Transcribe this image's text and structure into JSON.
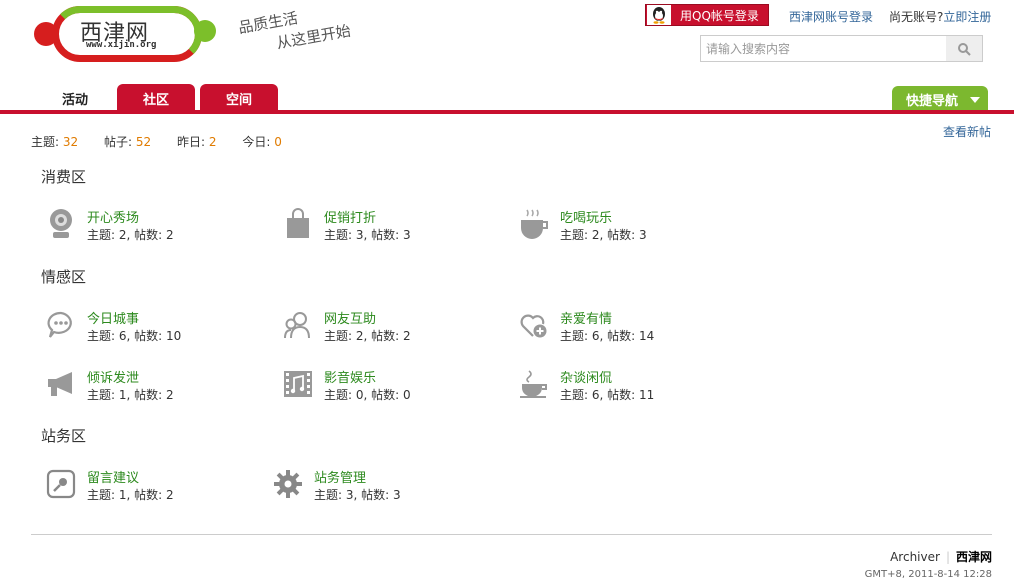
{
  "header": {
    "logo_name": "西津网",
    "logo_url": "www.xijin.org",
    "slogan_line1": "品质生活",
    "slogan_line2": "从这里开始",
    "qq_login": "用QQ帐号登录",
    "site_login": "西津网账号登录",
    "no_account": "尚无账号?",
    "register": "立即注册",
    "search_placeholder": "请输入搜索内容"
  },
  "nav": {
    "tabs": [
      {
        "label": "活动",
        "active": false
      },
      {
        "label": "社区",
        "active": true
      },
      {
        "label": "空间",
        "active": true
      }
    ],
    "quick_nav": "快捷导航"
  },
  "stats": {
    "topics_label": "主题:",
    "topics": "32",
    "posts_label": "帖子:",
    "posts": "52",
    "yesterday_label": "昨日:",
    "yesterday": "2",
    "today_label": "今日:",
    "today": "0",
    "view_new": "查看新帖"
  },
  "sections": [
    {
      "title": "消费区",
      "forums": [
        {
          "name": "开心秀场",
          "stat": "主题: 2, 帖数: 2",
          "icon": "webcam-icon"
        },
        {
          "name": "促销打折",
          "stat": "主题: 3, 帖数: 3",
          "icon": "shopping-bag-icon"
        },
        {
          "name": "吃喝玩乐",
          "stat": "主题: 2, 帖数: 3",
          "icon": "hot-cup-icon"
        }
      ]
    },
    {
      "title": "情感区",
      "forums": [
        {
          "name": "今日城事",
          "stat": "主题: 6, 帖数: 10",
          "icon": "chat-bubble-icon"
        },
        {
          "name": "网友互助",
          "stat": "主题: 2, 帖数: 2",
          "icon": "users-icon"
        },
        {
          "name": "亲爱有情",
          "stat": "主题: 6, 帖数: 14",
          "icon": "heart-plus-icon"
        },
        {
          "name": "倾诉发泄",
          "stat": "主题: 1, 帖数: 2",
          "icon": "megaphone-icon"
        },
        {
          "name": "影音娱乐",
          "stat": "主题: 0, 帖数: 0",
          "icon": "music-film-icon"
        },
        {
          "name": "杂谈闲侃",
          "stat": "主题: 6, 帖数: 11",
          "icon": "coffee-cup-icon"
        }
      ]
    },
    {
      "title": "站务区",
      "forums": [
        {
          "name": "留言建议",
          "stat": "主题: 1, 帖数: 2",
          "icon": "edit-note-icon"
        },
        {
          "name": "站务管理",
          "stat": "主题: 3, 帖数: 3",
          "icon": "gear-icon"
        }
      ]
    }
  ],
  "footer": {
    "archiver": "Archiver",
    "site": "西津网",
    "time": "GMT+8, 2011-8-14 12:28"
  }
}
